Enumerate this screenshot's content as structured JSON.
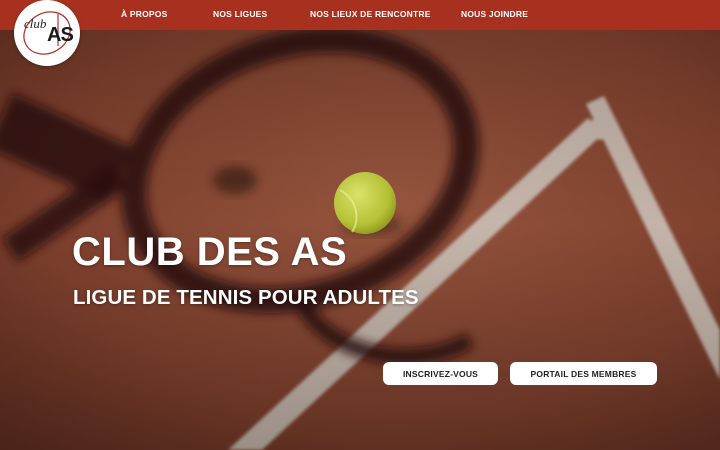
{
  "nav": {
    "items": [
      {
        "label": "À PROPOS"
      },
      {
        "label": "NOS LIGUES"
      },
      {
        "label": "NOS LIEUX DE RENCONTRE"
      },
      {
        "label": "NOUS JOINDRE"
      }
    ],
    "background": "#a8301f"
  },
  "logo": {
    "word": "club",
    "letters": "AS"
  },
  "hero": {
    "title": "CLUB DES AS",
    "subtitle": "LIGUE DE TENNIS POUR ADULTES",
    "background_description_colors": {
      "court": "#8a4a35",
      "line": "#c9c3bb",
      "ball": "#c8d64a"
    }
  },
  "buttons": {
    "signup_label": "INSCRIVEZ-VOUS",
    "portal_label": "PORTAIL DES MEMBRES"
  }
}
